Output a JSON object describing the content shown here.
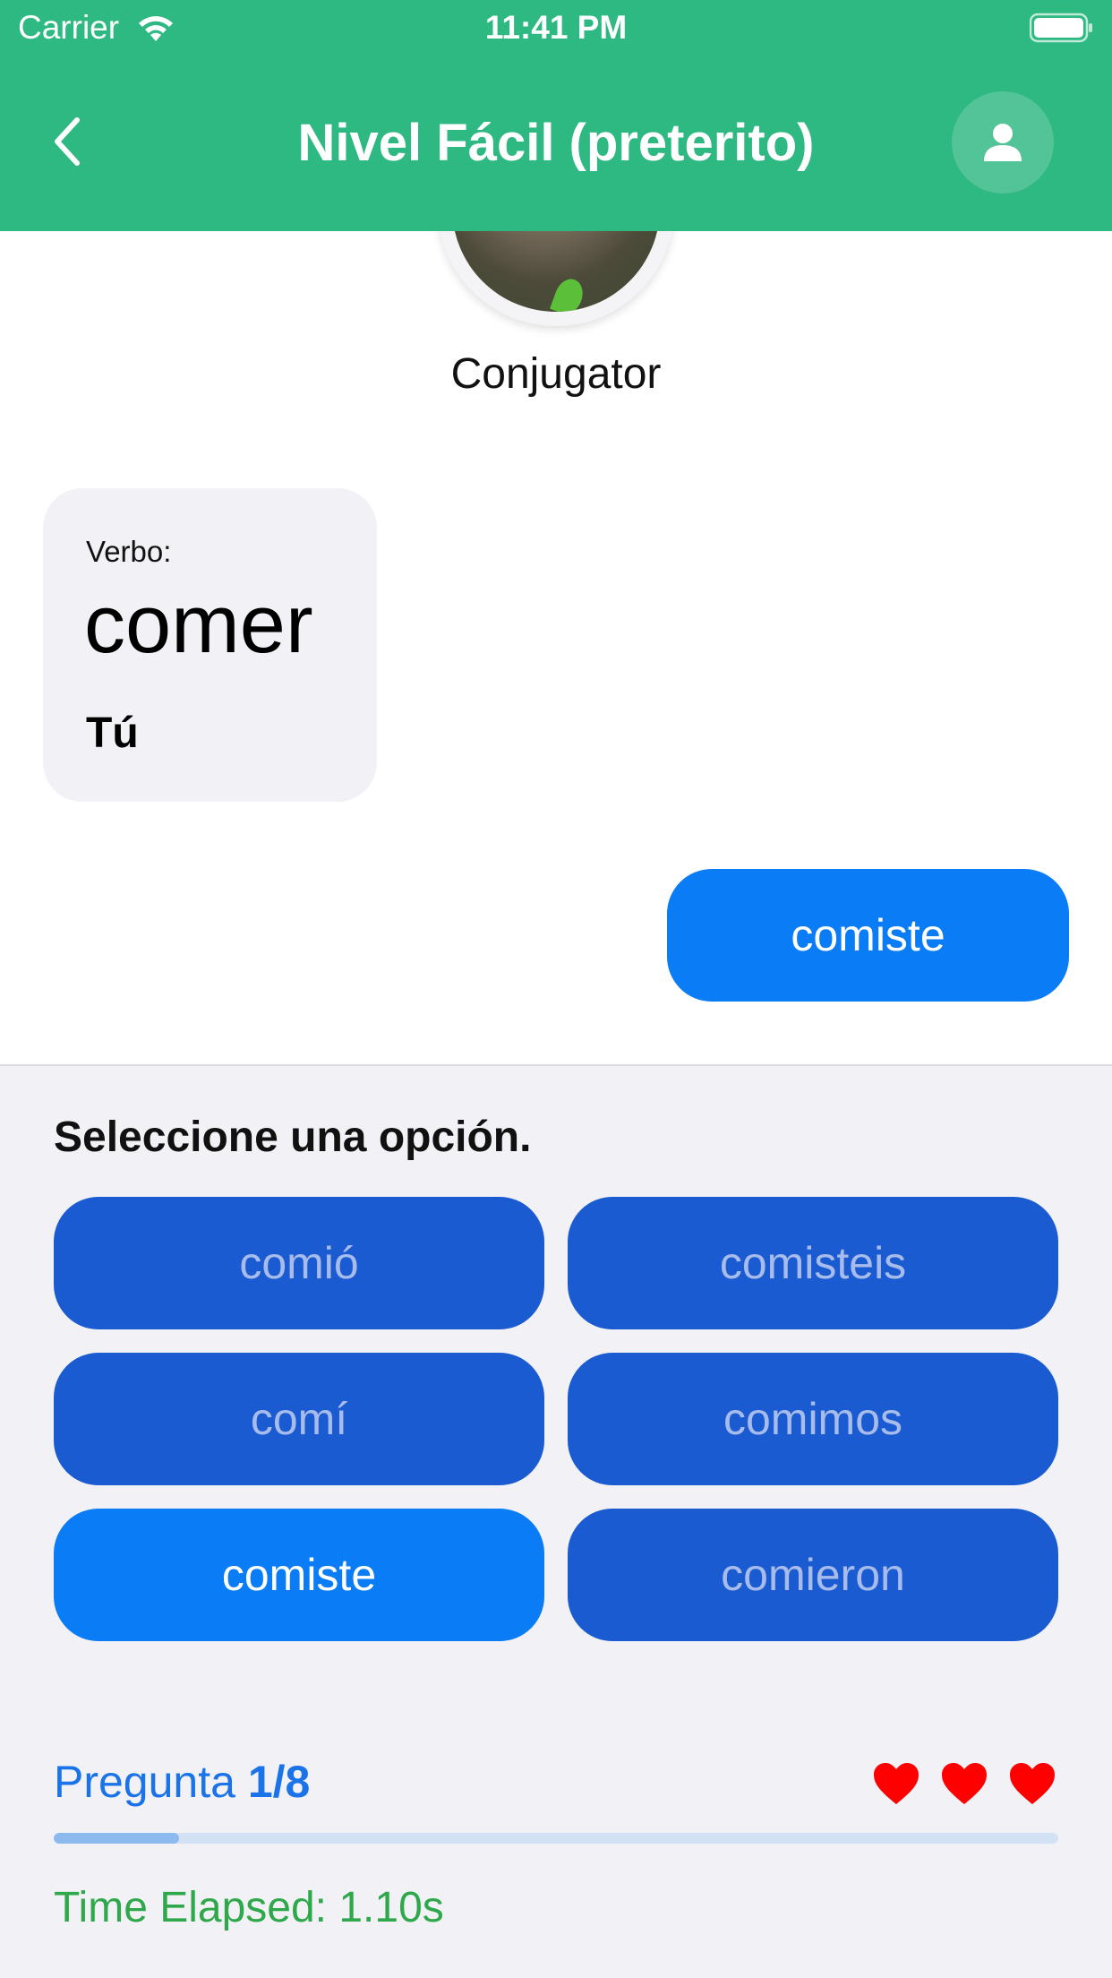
{
  "status_bar": {
    "carrier": "Carrier",
    "time": "11:41 PM"
  },
  "nav": {
    "title": "Nivel Fácil (preterito)",
    "back_icon": "chevron-left-icon",
    "profile_icon": "person-icon"
  },
  "app": {
    "name": "Conjugator"
  },
  "question": {
    "verb_label": "Verbo:",
    "verb": "comer",
    "pronoun": "Tú"
  },
  "answer": {
    "text": "comiste"
  },
  "options": {
    "prompt": "Seleccione una opción.",
    "items": [
      {
        "label": "comió",
        "selected": false
      },
      {
        "label": "comisteis",
        "selected": false
      },
      {
        "label": "comí",
        "selected": false
      },
      {
        "label": "comimos",
        "selected": false
      },
      {
        "label": "comiste",
        "selected": true
      },
      {
        "label": "comieron",
        "selected": false
      }
    ]
  },
  "progress": {
    "label": "Pregunta",
    "value": "1/8",
    "fraction": 0.125
  },
  "lives": {
    "count": 3,
    "icon": "heart-icon"
  },
  "timer": {
    "text": "Time Elapsed: 1.10s"
  },
  "colors": {
    "header": "#2EB882",
    "selected": "#0A7CF6",
    "option": "#1A5BD1",
    "option_text": "#A8BCEB",
    "progress_text": "#1A73E8",
    "time_text": "#2EA84A",
    "heart": "#FF0000"
  }
}
